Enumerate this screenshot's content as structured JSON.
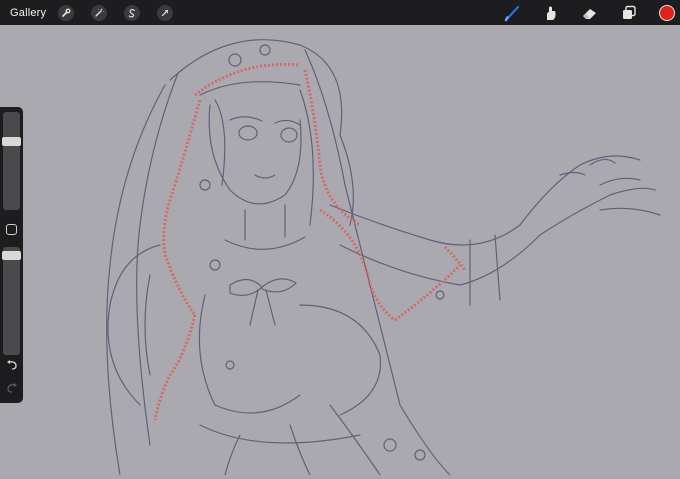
{
  "topbar": {
    "gallery_label": "Gallery",
    "left_tools": [
      "wrench-icon",
      "magic-wand-icon",
      "selection-icon",
      "transform-arrow-icon"
    ],
    "right_tools": [
      "brush-icon",
      "smudge-icon",
      "eraser-icon",
      "layers-icon"
    ],
    "current_color": "#e0201c",
    "brush_accent": "#2a6fe0"
  },
  "sidebar": {
    "brush_size_level": 0.72,
    "opacity_level": 0.96,
    "modifier_icon": "modifier-square-icon",
    "undo_icon": "undo-icon",
    "redo_icon": "redo-icon"
  },
  "canvas": {
    "background": "#aaa9b0",
    "sketch_color": "#4b4a67",
    "highlight_color": "#d8645f"
  }
}
